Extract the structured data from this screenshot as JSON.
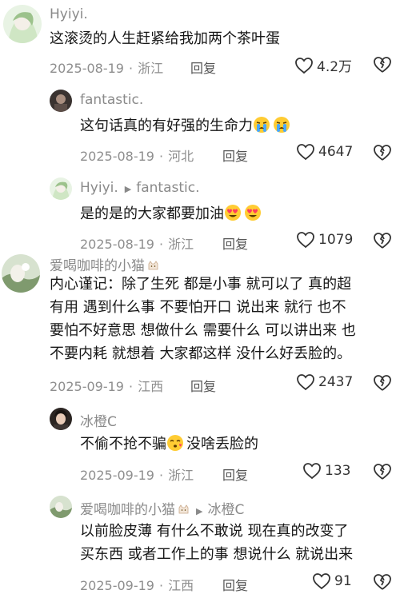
{
  "comments": [
    {
      "username": "Hyiyi.",
      "text": "这滚烫的人生赶紧给我加两个茶叶蛋",
      "date": "2025-08-19",
      "location": "浙江",
      "reply_label": "回复",
      "likes": "4.2万"
    },
    {
      "username": "fantastic.",
      "text": "这句话真的有好强的生命力",
      "emoji": [
        "crying-emoji",
        "crying-emoji"
      ],
      "date": "2025-08-19",
      "location": "河北",
      "reply_label": "回复",
      "likes": "4647"
    },
    {
      "username": "Hyiyi.",
      "reply_to": "fantastic.",
      "text": "是的是的大家都要加油",
      "emoji": [
        "heart-eyes-emoji",
        "heart-eyes-emoji"
      ],
      "date": "2025-08-19",
      "location": "浙江",
      "reply_label": "回复",
      "likes": "1079"
    },
    {
      "username": "爱喝咖啡的小猫",
      "text_lines": [
        "内心谨记：除了生死 都是小事 就可以了 真的超",
        "有用  遇到什么事 不要怕开口 说出来 就行 也不",
        "要怕不好意思 想做什么 需要什么 可以讲出来 也",
        "不要内耗  就想着 大家都这样 没什么好丢脸的。"
      ],
      "date": "2025-09-19",
      "location": "江西",
      "reply_label": "回复",
      "likes": "2437"
    },
    {
      "username": "冰橙C",
      "text_before": "不偷不抢不骗",
      "text_after": "没啥丢脸的",
      "emoji": [
        "kiss-emoji"
      ],
      "date": "2025-09-19",
      "location": "浙江",
      "reply_label": "回复",
      "likes": "133"
    },
    {
      "username": "爱喝咖啡的小猫",
      "reply_to": "冰橙C",
      "text_lines": [
        "以前脸皮薄 有什么不敢说 现在真的改变了",
        "买东西 或者工作上的事 想说什么 就说出来"
      ],
      "date": "2025-09-19",
      "location": "江西",
      "reply_label": "回复",
      "likes": "91"
    }
  ]
}
